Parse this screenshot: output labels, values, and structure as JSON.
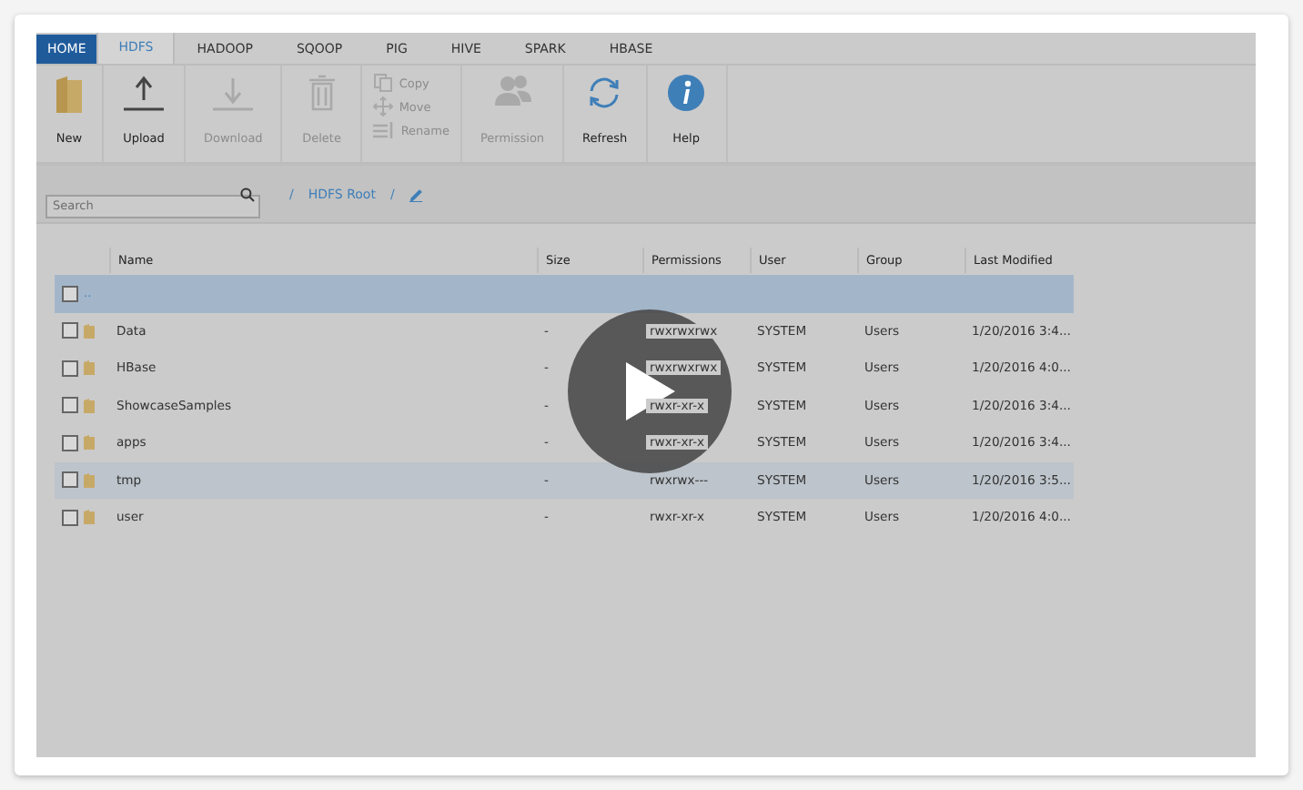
{
  "tabs": [
    {
      "label": "HOME",
      "kind": "home",
      "selected": false
    },
    {
      "label": "HDFS",
      "kind": "tab",
      "selected": true
    },
    {
      "label": "HADOOP",
      "kind": "tab",
      "selected": false
    },
    {
      "label": "SQOOP",
      "kind": "tab",
      "selected": false
    },
    {
      "label": "PIG",
      "kind": "tab",
      "selected": false
    },
    {
      "label": "HIVE",
      "kind": "tab",
      "selected": false
    },
    {
      "label": "SPARK",
      "kind": "tab",
      "selected": false
    },
    {
      "label": "HBASE",
      "kind": "tab",
      "selected": false
    }
  ],
  "ribbon": [
    {
      "kind": "large",
      "label": "New",
      "disabled": false
    },
    {
      "kind": "large",
      "label": "Upload",
      "disabled": false
    },
    {
      "kind": "large",
      "label": "Download",
      "disabled": true
    },
    {
      "kind": "large",
      "label": "Delete",
      "disabled": true
    },
    {
      "kind": "stack",
      "items": [
        {
          "label": "Copy",
          "disabled": true
        },
        {
          "label": "Move",
          "disabled": true
        },
        {
          "label": "Rename",
          "disabled": true
        }
      ]
    },
    {
      "kind": "large",
      "label": "Permission",
      "disabled": true
    },
    {
      "kind": "large",
      "label": "Refresh",
      "disabled": false
    },
    {
      "kind": "large",
      "label": "Help",
      "disabled": false
    }
  ],
  "search": {
    "placeholder": "Search"
  },
  "breadcrumb": [
    "/",
    "HDFS Root",
    "/"
  ],
  "table": {
    "columns": [
      "Name",
      "Size",
      "Permissions",
      "User",
      "Group",
      "Last Modified"
    ],
    "rows": [
      {
        "kind": "parent",
        "cells": [
          "..",
          "",
          "",
          "",
          "",
          ""
        ],
        "checked": false,
        "selected": true,
        "hovered": false
      },
      {
        "kind": "folder",
        "cells": [
          "Data",
          "-",
          "rwxrwxrwx",
          "SYSTEM",
          "Users",
          "1/20/2016 3:4..."
        ],
        "checked": false,
        "selected": false,
        "hovered": false
      },
      {
        "kind": "folder",
        "cells": [
          "HBase",
          "-",
          "rwxrwxrwx",
          "SYSTEM",
          "Users",
          "1/20/2016 4:0..."
        ],
        "checked": false,
        "selected": false,
        "hovered": false
      },
      {
        "kind": "folder",
        "cells": [
          "ShowcaseSamples",
          "-",
          "rwxr-xr-x",
          "SYSTEM",
          "Users",
          "1/20/2016 3:4..."
        ],
        "checked": false,
        "selected": false,
        "hovered": false
      },
      {
        "kind": "folder",
        "cells": [
          "apps",
          "-",
          "rwxr-xr-x",
          "SYSTEM",
          "Users",
          "1/20/2016 3:4..."
        ],
        "checked": false,
        "selected": false,
        "hovered": false
      },
      {
        "kind": "folder",
        "cells": [
          "tmp",
          "-",
          "rwxrwx---",
          "SYSTEM",
          "Users",
          "1/20/2016 3:5..."
        ],
        "checked": false,
        "selected": false,
        "hovered": true
      },
      {
        "kind": "folder",
        "cells": [
          "user",
          "-",
          "rwxr-xr-x",
          "SYSTEM",
          "Users",
          "1/20/2016 4:0..."
        ],
        "checked": false,
        "selected": false,
        "hovered": false
      }
    ]
  }
}
